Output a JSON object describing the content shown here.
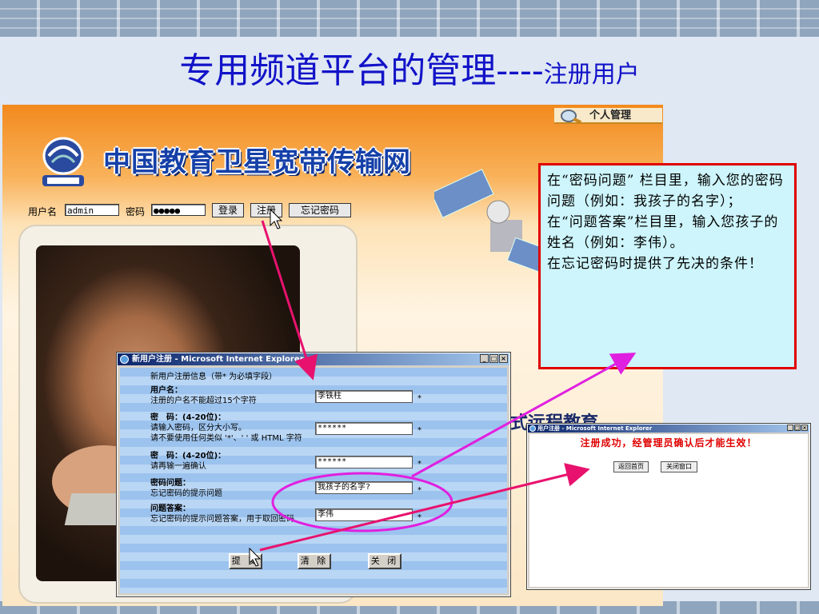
{
  "slide": {
    "title_main": "专用频道平台的管理----",
    "title_sub": "注册用户"
  },
  "site": {
    "personal_label": "个人管理",
    "banner_title": "中国教育卫星宽带传输网",
    "login": {
      "username_label": "用户名",
      "username_value": "admin",
      "password_label": "密码",
      "password_value": "●●●●●",
      "login_button": "登录",
      "register_button": "注册",
      "forgot_button": "忘记密码"
    },
    "remote_text": "式远程教育"
  },
  "callout": {
    "lines": [
      "在“密码问题” 栏目里，输入您的密码问题（例如：我孩子的名字）；",
      "在“问题答案”栏目里，输入您孩子的姓名（例如：李伟）。",
      "在忘记密码时提供了先决的条件！"
    ]
  },
  "register_window": {
    "title": "新用户注册 - Microsoft Internet Explorer",
    "controls": [
      "_",
      "□",
      "×"
    ],
    "header": "新用户注册信息（带* 为必填字段）",
    "fields": [
      {
        "label": "用户名：",
        "hint": "注册的户名不能超过15个字符",
        "value": "李铁柱",
        "required": "*"
      },
      {
        "label": "密　码：(4-20位)：",
        "hint": "请输入密码，区分大小写。",
        "hint2": "请不要使用任何类似 '*'、' ' 或 HTML 字符",
        "value": "******",
        "required": "*"
      },
      {
        "label": "密　码：(4-20位)：",
        "hint": "请再输一遍确认",
        "value": "******",
        "required": "*"
      },
      {
        "label": "密码问题：",
        "hint": "忘记密码的提示问题",
        "value": "我孩子的名字?",
        "required": "*"
      },
      {
        "label": "问题答案：",
        "hint": "忘记密码的提示问题答案，用于取回密码",
        "value": "李伟",
        "required": "*"
      }
    ],
    "buttons": {
      "submit": "提 交",
      "clear": "清 除",
      "close": "关 闭"
    }
  },
  "success_window": {
    "title": "用户注册 - Microsoft Internet Explorer",
    "controls": [
      "_",
      "□",
      "×"
    ],
    "message": "注册成功，经管理员确认后才能生效！",
    "buttons": {
      "home": "返回首页",
      "close": "关闭窗口"
    }
  },
  "colors": {
    "title_blue": "#1212c8",
    "callout_border": "#e00000",
    "callout_bg": "#cdf5fb",
    "arrow_red": "#e8126e",
    "arrow_magenta": "#e020e0"
  }
}
